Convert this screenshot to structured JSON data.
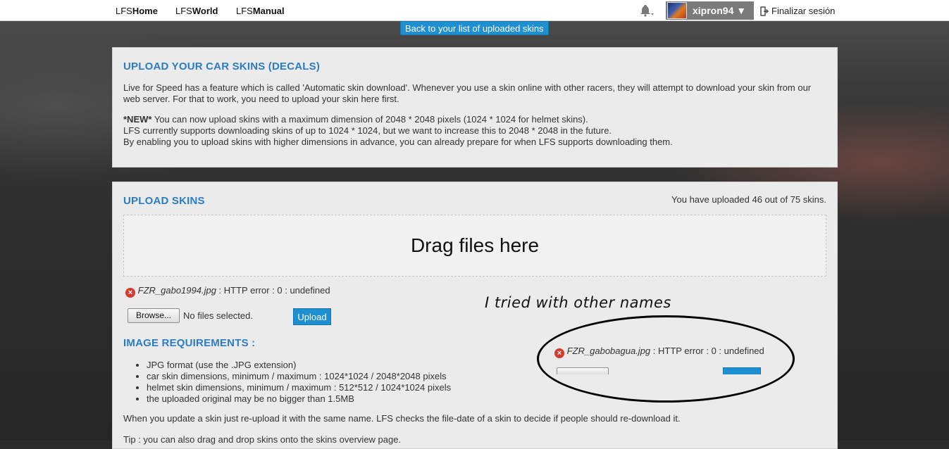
{
  "topnav": {
    "links": [
      {
        "prefix": "LFS",
        "bold": "Home"
      },
      {
        "prefix": "LFS",
        "bold": "World"
      },
      {
        "prefix": "LFS",
        "bold": "Manual"
      }
    ],
    "username": "xipron94 ▼",
    "logout_label": "Finalizar sesión"
  },
  "back_button": "Back to your list of uploaded skins",
  "intro": {
    "title": "UPLOAD YOUR CAR SKINS (DECALS)",
    "paragraph1": "Live for Speed has a feature which is called 'Automatic skin download'. Whenever you use a skin online with other racers, they will attempt to download your skin from our web server. For that to work, you need to upload your skin here first.",
    "new_tag": "*NEW*",
    "line1": " You can now upload skins with a maximum dimension of 2048 * 2048 pixels (1024 * 1024 for helmet skins).",
    "line2": "LFS currently supports downloading skins of up to 1024 * 1024, but we want to increase this to 2048 * 2048 in the future.",
    "line3": "By enabling you to upload skins with higher dimensions in advance, you can already prepare for when LFS supports downloading them."
  },
  "upload": {
    "title": "UPLOAD SKINS",
    "count_text": "You have uploaded 46 out of 75 skins.",
    "drop_zone": "Drag files here",
    "error1": {
      "filename": "FZR_gabo1994.jpg",
      "message": " : HTTP error : 0 : undefined"
    },
    "browse_label": "Browse...",
    "no_files": "No files selected.",
    "upload_label": "Upload",
    "requirements_title": "IMAGE REQUIREMENTS :",
    "requirements": [
      "JPG format (use the .JPG extension)",
      "car skin dimensions, minimum / maximum : 1024*1024 / 2048*2048 pixels",
      "helmet skin dimensions, minimum / maximum : 512*512 / 1024*1024 pixels",
      "the uploaded original may be no bigger than 1.5MB"
    ],
    "reupload_note": "When you update a skin just re-upload it with the same name. LFS checks the file-date of a skin to decide if people should re-download it.",
    "tip": "Tip : you can also drag and drop skins onto the skins overview page."
  },
  "annotation": {
    "text": "I tried with other names",
    "error2": {
      "filename": "FZR_gabobagua.jpg",
      "message": " : HTTP error : 0 : undefined"
    }
  }
}
